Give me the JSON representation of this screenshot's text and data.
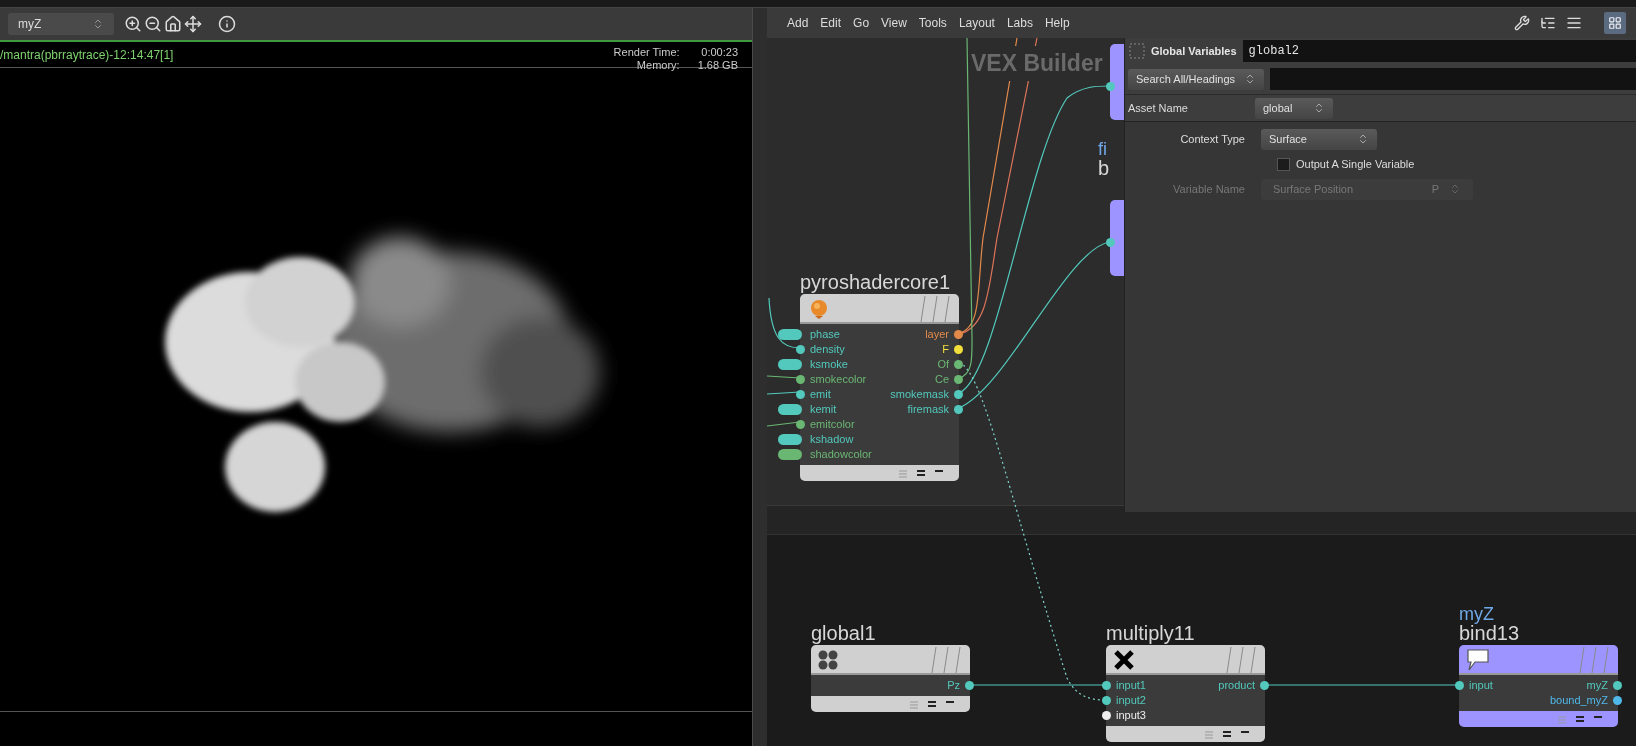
{
  "viewer": {
    "camera_menu": "myZ",
    "render_label": "/mantra(pbrraytrace)-12:14:47[1]",
    "stats": [
      {
        "label": "Render Time:",
        "value": "0:00:23"
      },
      {
        "label": "Memory:",
        "value": "1.68 GB"
      }
    ]
  },
  "network": {
    "menu": [
      "Add",
      "Edit",
      "Go",
      "View",
      "Tools",
      "Layout",
      "Labs",
      "Help"
    ],
    "context_label": "VEX Builder",
    "partial_node": {
      "comment": "fi",
      "name": "b"
    },
    "nodes": [
      {
        "name": "pyroshadercore1",
        "kind": "pyro",
        "color": "#d0d0d0",
        "inputs": [
          {
            "name": "phase",
            "kind": "pill",
            "color": "#52c9bc"
          },
          {
            "name": "density",
            "kind": "dot",
            "color": "#52c9bc"
          },
          {
            "name": "ksmoke",
            "kind": "pill",
            "color": "#52c9bc"
          },
          {
            "name": "smokecolor",
            "kind": "dot",
            "color": "#6ab673"
          },
          {
            "name": "emit",
            "kind": "dot",
            "color": "#52c9bc"
          },
          {
            "name": "kemit",
            "kind": "pill",
            "color": "#52c9bc"
          },
          {
            "name": "emitcolor",
            "kind": "dot",
            "color": "#6ab673"
          },
          {
            "name": "kshadow",
            "kind": "pill",
            "color": "#52c9bc"
          },
          {
            "name": "shadowcolor",
            "kind": "pill",
            "color": "#6ab673"
          }
        ],
        "outputs": [
          {
            "name": "layer",
            "color": "#e38a4a"
          },
          {
            "name": "F",
            "color": "#f2df3c"
          },
          {
            "name": "Of",
            "color": "#6ab673"
          },
          {
            "name": "Ce",
            "color": "#6ab673"
          },
          {
            "name": "smokemask",
            "color": "#52c9bc"
          },
          {
            "name": "firemask",
            "color": "#52c9bc"
          }
        ]
      },
      {
        "name": "global1",
        "kind": "global",
        "color": "#d0d0d0",
        "outputs": [
          {
            "name": "Pz",
            "color": "#52c9bc"
          }
        ]
      },
      {
        "name": "multiply11",
        "kind": "multiply",
        "color": "#d0d0d0",
        "inputs": [
          {
            "name": "input1",
            "kind": "dot",
            "color": "#52c9bc"
          },
          {
            "name": "input2",
            "kind": "dot",
            "color": "#52c9bc"
          },
          {
            "name": "input3",
            "kind": "dot",
            "color": "#eeeeee"
          }
        ],
        "outputs": [
          {
            "name": "product",
            "color": "#52c9bc"
          }
        ]
      },
      {
        "name": "bind13",
        "comment": "myZ",
        "kind": "bind",
        "color": "#9d94ff",
        "inputs": [
          {
            "name": "input",
            "kind": "dot",
            "color": "#52c9bc"
          }
        ],
        "outputs": [
          {
            "name": "myZ",
            "color": "#52c9bc"
          },
          {
            "name": "bound_myZ",
            "color": "#4fb8ea"
          }
        ]
      }
    ]
  },
  "parameters": {
    "type_label": "Global Variables",
    "node_name": "global2",
    "search_mode": "Search All/Headings",
    "asset_name": {
      "label": "Asset Name",
      "value": "global"
    },
    "context_type": {
      "label": "Context Type",
      "value": "Surface"
    },
    "output_single": {
      "label": "Output A Single Variable",
      "checked": false
    },
    "variable_name": {
      "label": "Variable Name",
      "value": "Surface Position",
      "suffix": "P",
      "disabled": true
    }
  }
}
